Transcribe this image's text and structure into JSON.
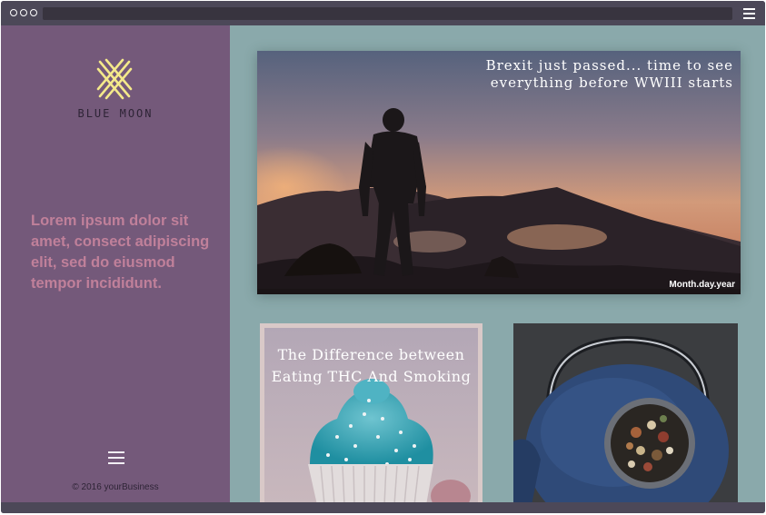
{
  "browser": {
    "window_dots": 3,
    "menu_icon": "hamburger-menu-icon"
  },
  "sidebar": {
    "logo_icon": "crossed-stitch-logo-icon",
    "brand": "BLUE MOON",
    "tagline": "Lorem ipsum dolor sit amet, consect adipiscing elit, sed do eiusmod tempor incididunt.",
    "menu_icon": "hamburger-menu-icon",
    "copyright": "© 2016 yourBusiness"
  },
  "hero": {
    "title": "Brexit just passed... time to see everything before WWIII starts",
    "date": "Month.day.year"
  },
  "cards": [
    {
      "title": "The Difference between Eating THC And Smoking"
    }
  ],
  "colors": {
    "sidebar": "#74597a",
    "content": "#8aa9ab",
    "frame": "#4c4858",
    "tagline": "#c0809a",
    "logo": "#f4e98a"
  }
}
